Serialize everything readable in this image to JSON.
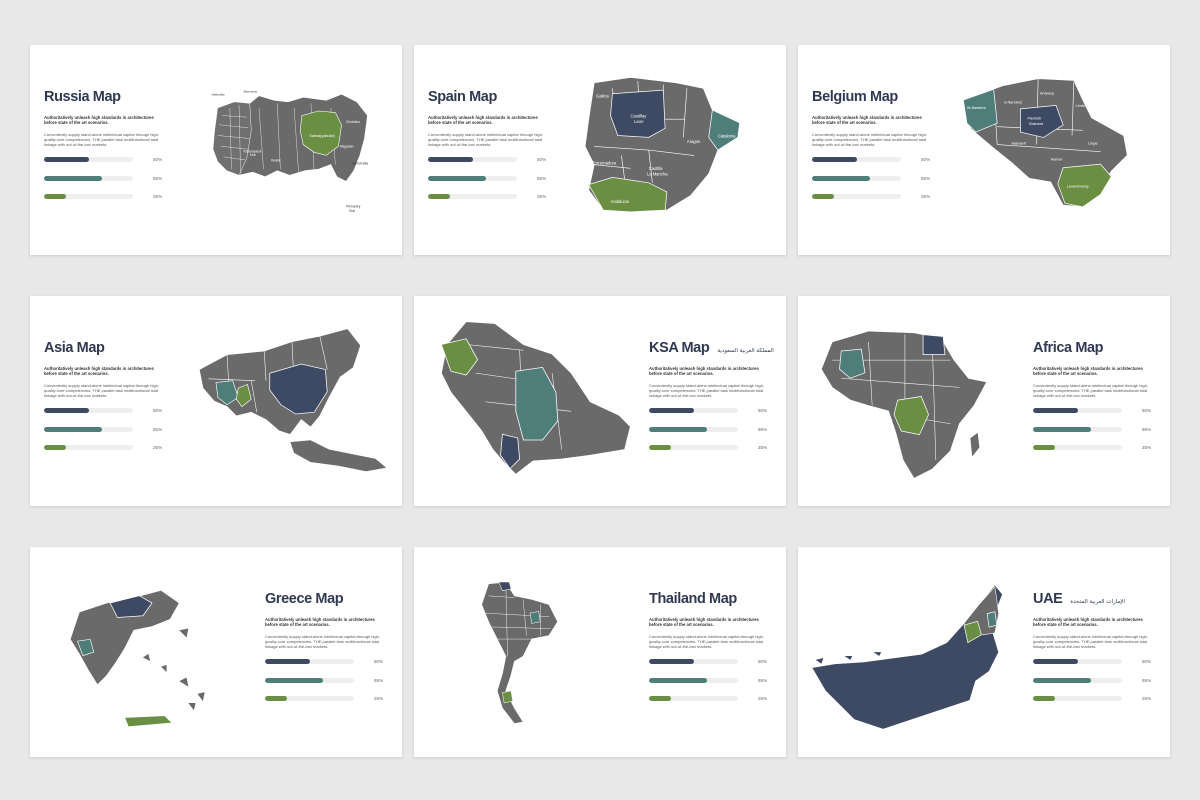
{
  "colors": {
    "navy": "#3e4a63",
    "teal": "#4f7e7a",
    "green": "#6a8f43",
    "land": "#6a6a6a"
  },
  "common": {
    "subtitle": "Authoritatively unleash high standards in architectures before state of the art scenarios.",
    "description": "Conveniently supply stand-alone intellectual capital through high-quality core competencies. THE parallel task multifunctional total linkage with out-of-the-box markets.",
    "bars": [
      {
        "value": 0.5,
        "label": "50%",
        "color": "#3e4a63"
      },
      {
        "value": 0.65,
        "label": "65%",
        "color": "#4f7e7a"
      },
      {
        "value": 0.25,
        "label": "25%",
        "color": "#6a8f43"
      }
    ]
  },
  "slides": [
    {
      "title": "Russia Map",
      "arabic": "",
      "regions": [
        "Nakhodka",
        "Murmansk",
        "Kaliningrad",
        "Komi",
        "Sakha(yakutia)",
        "Krasnoyarsk Krai",
        "Irkutsk",
        "Chukotka",
        "Magadan",
        "Kamchatka",
        "Primorsky Krai",
        "Amur",
        "Tomsk",
        "Khabarovsk",
        "Zabaykalsky",
        "Tyumen"
      ]
    },
    {
      "title": "Spain Map",
      "arabic": "",
      "regions": [
        "Galicia",
        "Asturias",
        "Castillay Leon",
        "Navarra",
        "Aragon",
        "Catalonia",
        "Extremadura",
        "Madrid",
        "Castilla La Mancha",
        "Valencia",
        "Murcia",
        "Andalucia"
      ]
    },
    {
      "title": "Belgium Map",
      "arabic": "",
      "regions": [
        "Antwerp",
        "E-flanders",
        "W-flanders",
        "Limburg",
        "Flemish Brabant",
        "Hainault",
        "Liege",
        "Namur",
        "Luxembourg"
      ]
    },
    {
      "title": "Asia Map",
      "arabic": "",
      "regions": []
    },
    {
      "title": "KSA Map",
      "arabic": "المملكة العربية السعودية",
      "regions": []
    },
    {
      "title": "Africa Map",
      "arabic": "",
      "regions": []
    },
    {
      "title": "Greece Map",
      "arabic": "",
      "regions": []
    },
    {
      "title": "Thailand Map",
      "arabic": "",
      "regions": []
    },
    {
      "title": "UAE",
      "arabic": "الإمارات العربية المتحدة",
      "regions": []
    }
  ]
}
